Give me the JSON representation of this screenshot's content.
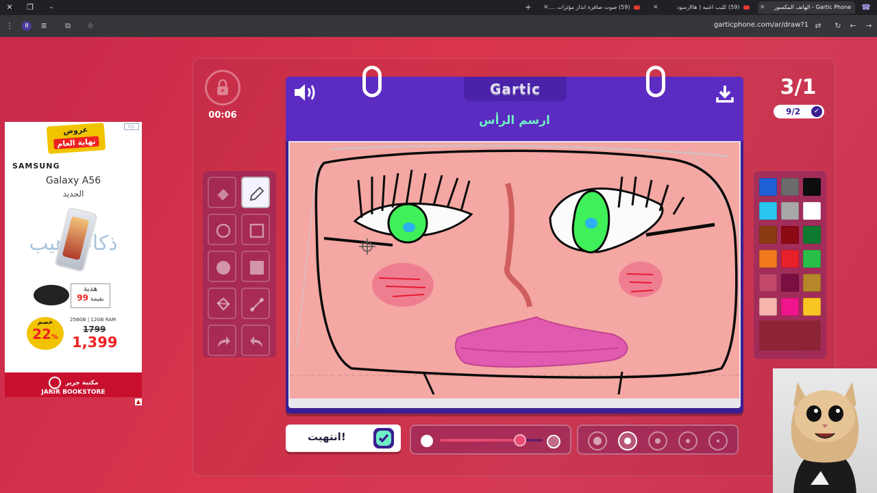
{
  "browser": {
    "tabs": [
      {
        "label": "Gartic Phone - الهاتف المكسور",
        "active": true
      },
      {
        "label": "(59) كليب اغنيه ( هااارسود",
        "active": false
      },
      {
        "label": "(59) صوت صافرة انذار مؤثرات ....",
        "active": false
      }
    ],
    "url": "garticphone.com/ar/draw?1",
    "extension_badge": "8"
  },
  "ad": {
    "badge_line1": "عروض",
    "badge_line2": "نهاية العام",
    "brand": "SAMSUNG",
    "model": "Galaxy A56",
    "model_sub": "الجديد",
    "ai_text": "ذكاء رهيب",
    "gift_label": "هدية",
    "gift_value_prefix": "بقيمة",
    "gift_value": "99",
    "spec": "256GB | 12GB RAM",
    "old_price": "1799",
    "new_price": "1,399",
    "discount_label": "خصم",
    "discount_value": "22",
    "discount_unit": "%",
    "store": "JARIR BOOKSTORE",
    "store_ar": "مكتبة جرير",
    "info_badge": "i ▷"
  },
  "timer": {
    "value": "00:06"
  },
  "pad": {
    "logo": "Gartic",
    "task": "ارسم الرأس"
  },
  "round": {
    "value": "3/1",
    "progress": "9/2"
  },
  "done_button": {
    "label": "انتهيت!"
  },
  "opacity_slider": {
    "value_fraction": 0.78
  },
  "brush_sizes": {
    "count": 5,
    "selected_index": 1
  },
  "palette": {
    "colors": [
      "#1f5fd6",
      "#6b6b6b",
      "#0d0d0d",
      "#2ac5f0",
      "#a8a8a8",
      "#ffffff",
      "#8a3b12",
      "#8c0a14",
      "#0f7a2f",
      "#f07a1c",
      "#e8202a",
      "#28c04a",
      "#c2486a",
      "#7a1041",
      "#b6862a",
      "#f6b6ae",
      "#f0158c",
      "#f8c623"
    ],
    "current": "#8c2436"
  },
  "tools": [
    "eraser",
    "pencil",
    "ellipse-outline",
    "rectangle-outline",
    "ellipse-filled",
    "rectangle-filled",
    "fill-bucket",
    "line",
    "undo",
    "redo"
  ],
  "colors": {
    "background": "#d43a55",
    "pad": "#3b1f92",
    "task_text": "#6ff0c4",
    "canvas": "#f4a7a3"
  }
}
